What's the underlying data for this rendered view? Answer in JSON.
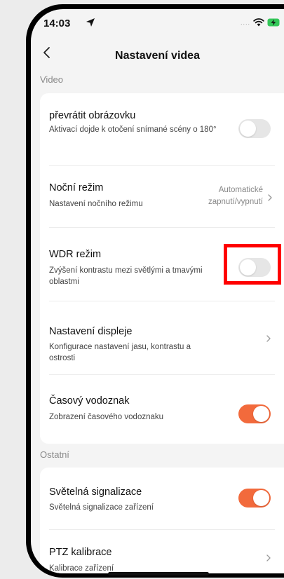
{
  "status_bar": {
    "time": "14:03",
    "signal": "....",
    "battery": "charging"
  },
  "nav": {
    "title": "Nastavení videa"
  },
  "sections": {
    "video": "Video",
    "other": "Ostatní"
  },
  "rows": {
    "flip": {
      "title": "převrátit obrázovku",
      "subtitle": "Aktivací dojde k otočení snímané scény o 180°",
      "toggle": "off"
    },
    "night": {
      "title": "Noční režim",
      "subtitle": "Nastavení nočního režimu",
      "value": "Automatické zapnutí/vypnutí"
    },
    "wdr": {
      "title": "WDR režim",
      "subtitle": "Zvýšení kontrastu mezi světlými a tmavými oblastmi",
      "toggle": "off"
    },
    "display": {
      "title": "Nastavení displeje",
      "subtitle": "Konfigurace nastavení jasu, kontrastu a ostrosti"
    },
    "watermark": {
      "title": "Časový vodoznak",
      "subtitle": "Zobrazení časového vodoznaku",
      "toggle": "on"
    },
    "light": {
      "title": "Světelná signalizace",
      "subtitle": "Světelná signalizace zařízení",
      "toggle": "on"
    },
    "ptz": {
      "title": "PTZ kalibrace",
      "subtitle": "Kalibrace zařízení"
    }
  },
  "colors": {
    "accent": "#f26a3c",
    "highlight": "#ff0000",
    "background": "#f4f4f4"
  }
}
